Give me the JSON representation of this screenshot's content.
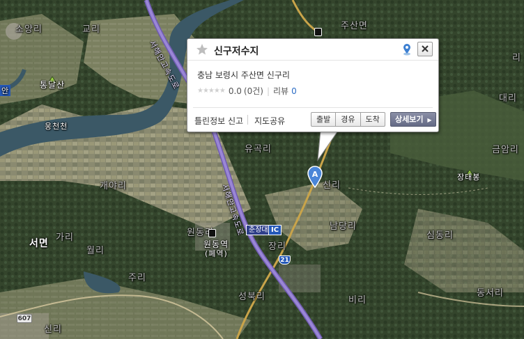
{
  "map": {
    "place_labels": [
      {
        "id": "soyang-ri",
        "text": "소양리",
        "style": "faint"
      },
      {
        "id": "gyogol-ri",
        "text": "교리",
        "style": "faint"
      },
      {
        "id": "tongdalsan",
        "text": "통달산",
        "style": "normal"
      },
      {
        "id": "ungcheoncheon",
        "text": "웅천천",
        "style": "small"
      },
      {
        "id": "jusanmyeon",
        "text": "주산면",
        "style": "faint"
      },
      {
        "id": "ri-right-top",
        "text": "리",
        "style": "faint"
      },
      {
        "id": "daeri",
        "text": "대리",
        "style": "faint"
      },
      {
        "id": "geumam-ri",
        "text": "금암리",
        "style": "faint"
      },
      {
        "id": "yugok-ri",
        "text": "유곡리",
        "style": "faint"
      },
      {
        "id": "sinmyeong-ri",
        "text": "신리",
        "style": "faint"
      },
      {
        "id": "jangtaebong",
        "text": "장태봉",
        "style": "normal"
      },
      {
        "id": "gaya-ri",
        "text": "개야리",
        "style": "faint"
      },
      {
        "id": "namdang-ri",
        "text": "남당리",
        "style": "faint"
      },
      {
        "id": "simdong-ri",
        "text": "심동리",
        "style": "faint"
      },
      {
        "id": "seomyeon",
        "text": "서면",
        "style": "bold"
      },
      {
        "id": "wolgok-ri",
        "text": "월리",
        "style": "faint"
      },
      {
        "id": "gapdo-ri",
        "text": "가리",
        "style": "faint"
      },
      {
        "id": "ju-ri",
        "text": "주리",
        "style": "faint"
      },
      {
        "id": "wondong-ri",
        "text": "원동리",
        "style": "faint"
      },
      {
        "id": "seongbuk-ri",
        "text": "성북리",
        "style": "faint"
      },
      {
        "id": "jangri",
        "text": "장리",
        "style": "faint"
      },
      {
        "id": "bigeom-ri",
        "text": "비리",
        "style": "faint"
      },
      {
        "id": "dongseo-ri",
        "text": "동서리",
        "style": "faint"
      },
      {
        "id": "sinang-ri",
        "text": "신리",
        "style": "faint"
      },
      {
        "id": "an",
        "text": "안",
        "style": "normal"
      }
    ],
    "station_label": "원동역",
    "station_sub": "(폐역)",
    "ic_label": "춘장대",
    "ic_badge": "IC",
    "route_21": "21",
    "route_607": "607",
    "highway_label_top": "서해안고속도로",
    "highway_label_mid": "서해안고속도로",
    "marker_letter": "A"
  },
  "popup": {
    "title": "신구저수지",
    "address": "충남 보령시 주산면 신구리",
    "rating_stars": "★★★★★",
    "rating_value": "0.0",
    "rating_count": "(0건)",
    "review_label": "리뷰",
    "review_count": "0",
    "report_link": "틀린정보 신고",
    "share_link": "지도공유",
    "btn_depart": "출발",
    "btn_via": "경유",
    "btn_arrive": "도착",
    "btn_detail": "상세보기"
  },
  "colors": {
    "highway": "#9a86d6",
    "road": "#c9a44a",
    "button_detail": "#6e7490",
    "link_blue": "#2b6cc4"
  }
}
